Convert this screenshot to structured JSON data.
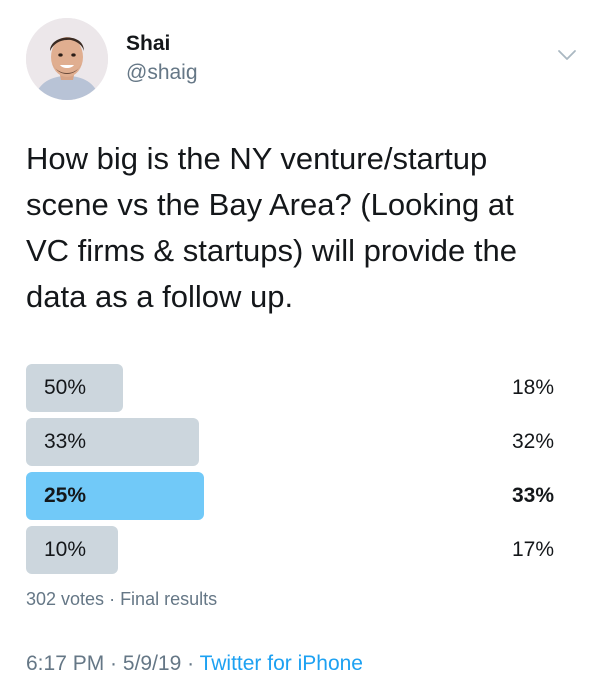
{
  "author": {
    "display_name": "Shai",
    "handle": "@shaig"
  },
  "tweet": {
    "text": "How big is the NY venture/startup\nscene vs the Bay Area? (Looking at\nVC firms & startups) will provide the\ndata as a follow up."
  },
  "poll": {
    "options": [
      {
        "label": "50%",
        "percent_text": "18%",
        "share": 0.18,
        "winner": false
      },
      {
        "label": "33%",
        "percent_text": "32%",
        "share": 0.32,
        "winner": false
      },
      {
        "label": "25%",
        "percent_text": "33%",
        "share": 0.33,
        "winner": true
      },
      {
        "label": "10%",
        "percent_text": "17%",
        "share": 0.17,
        "winner": false
      }
    ],
    "votes": "302 votes",
    "separator": " · ",
    "status": "Final results"
  },
  "footer": {
    "time": "6:17 PM",
    "separator_1": " · ",
    "date": "5/9/19",
    "separator_2": " · ",
    "source": "Twitter for iPhone"
  },
  "colors": {
    "bar": "#ccd6dd",
    "winner_bar": "#71c9f8",
    "link": "#1da1f2",
    "muted": "#657786"
  },
  "icons": {
    "chevron": "chevron-down-icon"
  }
}
